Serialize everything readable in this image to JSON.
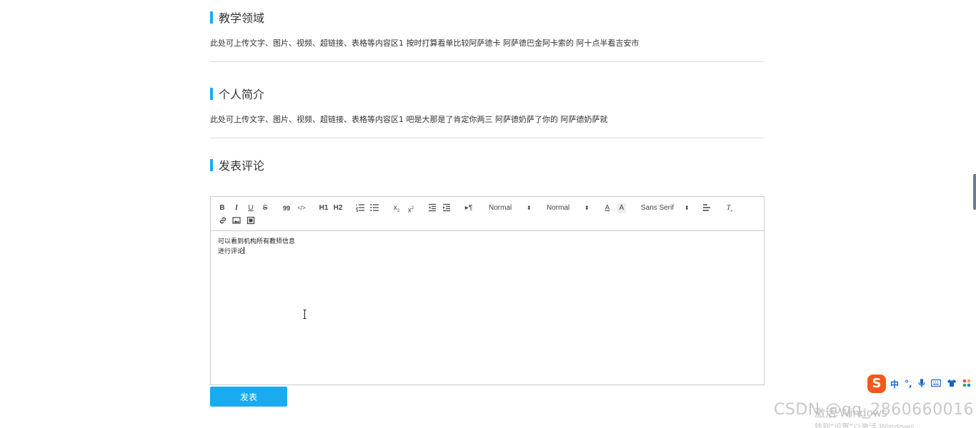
{
  "sections": [
    {
      "title": "教学领域",
      "text": "此处可上传文字、图片、视频、超链接、表格等内容区1 按时打算看单比较阿萨德卡 阿萨德巴金阿卡索的 阿十点半看吉安市"
    },
    {
      "title": "个人简介",
      "text": "此处可上传文字、图片、视频、超链接、表格等内容区1 吧是大那是了肯定你两三 阿萨德奶萨了你的 阿萨德奶萨就"
    }
  ],
  "comment": {
    "title": "发表评论",
    "toolbar": {
      "header_picker": "Normal",
      "size_picker": "Normal",
      "font_picker": "Sans Serif",
      "bold": "B",
      "italic": "I",
      "underline": "U",
      "strike": "S",
      "quote": "99",
      "code": "</>",
      "h1": "H1",
      "h2": "H2",
      "sub": "x2",
      "sup": "x2",
      "rtl": "¶"
    },
    "lines": [
      "可以看到机构所有教师信息",
      "进行评论"
    ],
    "submit_label": "发表"
  },
  "ime": {
    "logo": "S",
    "items": [
      "中",
      "°,"
    ]
  },
  "watermark": "CSDN @qq_2860660016",
  "windows_activation": {
    "line1": "激活 Windows",
    "line2": "转到\"设置\"以激活 Windows。"
  },
  "colors": {
    "accent": "#1aaaf0",
    "divider": "#d9d9d9",
    "ime_logo": "#f05a1a"
  }
}
